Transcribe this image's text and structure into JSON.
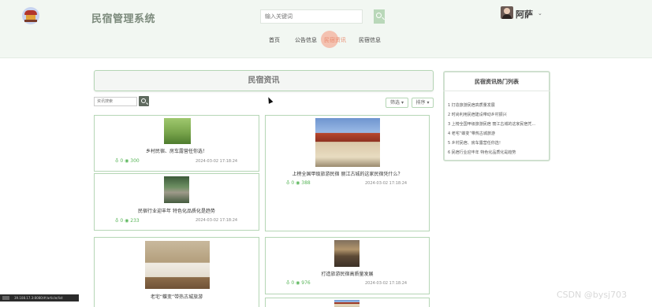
{
  "header": {
    "site_title": "民宿管理系统",
    "search_placeholder": "输入关键词",
    "username": "阿萨",
    "nav": [
      "首页",
      "公告信息",
      "民宿资讯",
      "民宿信息"
    ],
    "active_nav": "民宿资讯"
  },
  "page": {
    "title": "民宿资讯",
    "filter_placeholder": "资讯搜索",
    "filter_label": "筛选",
    "sort_label": "排序"
  },
  "cards": [
    {
      "title": "乡村民宿、房车露营任你选！",
      "likes": "0",
      "views": "300",
      "date": "2024-03-02 17:18:24",
      "image": "grass"
    },
    {
      "title": "民宿行业迎丰年 特色化品质化是趋势",
      "likes": "0",
      "views": "233",
      "date": "2024-03-02 17:18:24",
      "image": "garden"
    },
    {
      "title": "上榜全国甲级旅游民宿 丽江古城的这家民宿凭什么？",
      "likes": "0",
      "views": "388",
      "date": "2024-03-02 17:18:24",
      "image": "temple"
    },
    {
      "title": "打造旅游民宿高质量发展",
      "likes": "0",
      "views": "976",
      "date": "2024-03-02 17:18:24",
      "image": "courtyard"
    },
    {
      "title": "老宅“蝶变”带热古城旅游",
      "image": "room"
    }
  ],
  "sidebar": {
    "title": "民宿资讯热门列表",
    "items": [
      "1 打造旅游民宿高质量发展",
      "2 时尚利用民宿建设带动乡村振兴",
      "3 上榜全国甲级旅游民宿 丽江古城的这家民宿凭…",
      "4 老宅“蝶变”带热古城旅游",
      "5 乡村民宿、房车露营任你选！",
      "6 民宿行业迎丰年 特色化品质化是趋势"
    ]
  },
  "statusbar": {
    "url": "39.108.17.3:8080/#/article/list"
  },
  "watermark": "CSDN @bysj703",
  "colors": {
    "accent": "#b5d6b5",
    "stat": "#58b558",
    "active_nav": "#e98b6f"
  },
  "icons": [
    "logo-icon",
    "search-icon",
    "like-icon",
    "view-icon",
    "chevron-down-icon"
  ]
}
